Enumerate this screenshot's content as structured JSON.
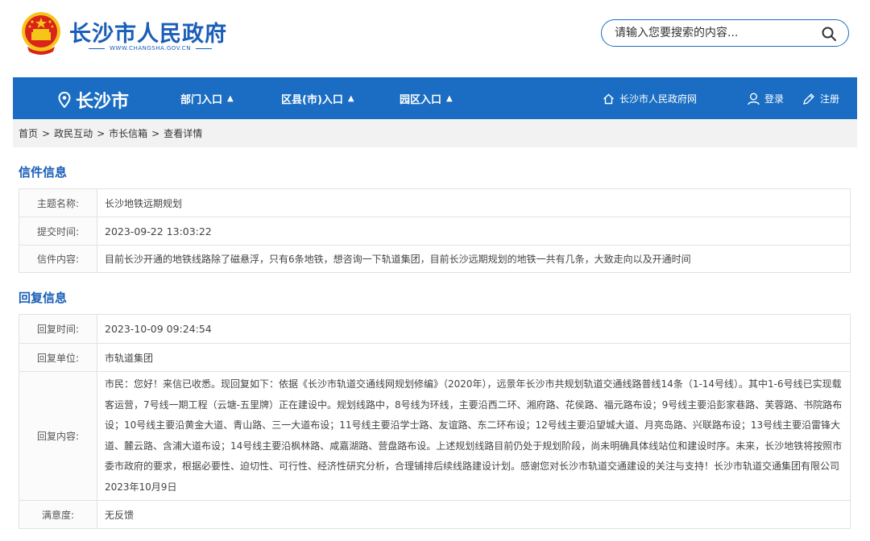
{
  "header": {
    "site_title": "长沙市人民政府",
    "site_url": "WWW.CHANGSHA.GOV.CN",
    "search_placeholder": "请输入您要搜索的内容..."
  },
  "nav": {
    "city": "长沙市",
    "menus": [
      {
        "label": "部门入口"
      },
      {
        "label": "区县(市)入口"
      },
      {
        "label": "园区入口"
      }
    ],
    "portal_link": "长沙市人民政府网",
    "login": "登录",
    "register": "注册"
  },
  "breadcrumb": [
    "首页",
    "政民互动",
    "市长信箱",
    "查看详情"
  ],
  "letter": {
    "section_title": "信件信息",
    "rows": [
      {
        "label": "主题名称:",
        "value": "长沙地铁远期规划"
      },
      {
        "label": "提交时间:",
        "value": "2023-09-22 13:03:22"
      },
      {
        "label": "信件内容:",
        "value": "目前长沙开通的地铁线路除了磁悬浮，只有6条地铁，想咨询一下轨道集团，目前长沙远期规划的地铁一共有几条，大致走向以及开通时间"
      }
    ]
  },
  "reply": {
    "section_title": "回复信息",
    "rows": [
      {
        "label": "回复时间:",
        "value": "2023-10-09 09:24:54"
      },
      {
        "label": "回复单位:",
        "value": "市轨道集团"
      },
      {
        "label": "回复内容:",
        "value": "市民：您好！来信已收悉。现回复如下：依据《长沙市轨道交通线网规划修编》（2020年），远景年长沙市共规划轨道交通线路普线14条（1-14号线）。其中1-6号线已实现载客运营，7号线一期工程（云塘-五里牌）正在建设中。规划线路中，8号线为环线，主要沿西二环、湘府路、花侯路、福元路布设；9号线主要沿彭家巷路、芙蓉路、书院路布设；10号线主要沿黄金大道、青山路、三一大道布设；11号线主要沿学士路、友谊路、东二环布设；12号线主要沿望城大道、月亮岛路、兴联路布设；13号线主要沿雷锋大道、麓云路、含浦大道布设；14号线主要沿枫林路、咸嘉湖路、营盘路布设。上述规划线路目前仍处于规划阶段，尚未明确具体线站位和建设时序。未来，长沙地铁将按照市委市政府的要求，根据必要性、迫切性、可行性、经济性研究分析，合理铺排后续线路建设计划。感谢您对长沙市轨道交通建设的关注与支持！长沙市轨道交通集团有限公司2023年10月9日"
      },
      {
        "label": "满意度:",
        "value": "无反馈"
      }
    ]
  },
  "colors": {
    "brand_blue": "#1a6dc2",
    "emblem_red": "#d9231b",
    "emblem_gold": "#f5c518"
  }
}
